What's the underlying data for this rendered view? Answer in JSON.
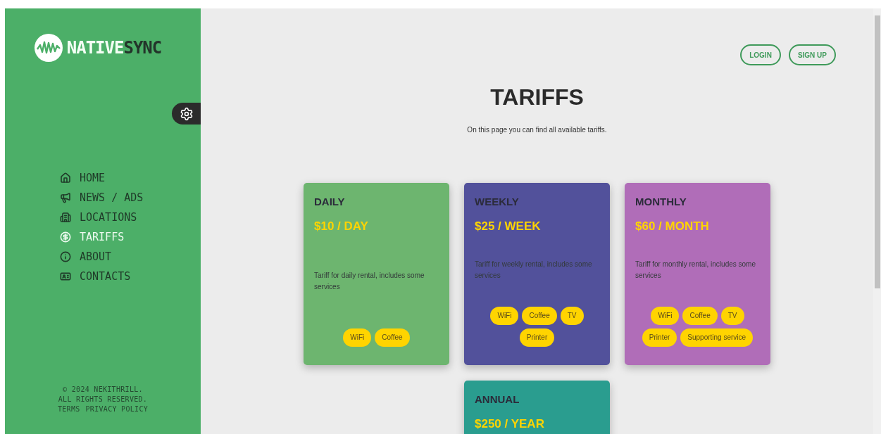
{
  "sidebar": {
    "logo": {
      "primary": "NATIVE",
      "secondary": "SYNC"
    },
    "nav": [
      {
        "label": "HOME",
        "selected": false
      },
      {
        "label": "NEWS / ADS",
        "selected": false
      },
      {
        "label": "LOCATIONS",
        "selected": false
      },
      {
        "label": "TARIFFS",
        "selected": true
      },
      {
        "label": "ABOUT",
        "selected": false
      },
      {
        "label": "CONTACTS",
        "selected": false
      }
    ],
    "footer": {
      "copyright": "© 2024 NEKITHRILL.",
      "rights": "ALL RIGHTS RESERVED.",
      "links": [
        "TERMS",
        "PRIVACY POLICY"
      ]
    }
  },
  "header": {
    "buttons": [
      "LOGIN",
      "SIGN UP"
    ]
  },
  "title": "TARIFFS",
  "subtitle": "On this page you can find all available tariffs.",
  "tariffs": [
    {
      "name": "DAILY",
      "price": "$10 / DAY",
      "color": "#6db56f",
      "description": "Tariff for daily rental, includes some services",
      "services": [
        "WiFi",
        "Coffee"
      ]
    },
    {
      "name": "WEEKLY",
      "price": "$25 / WEEK",
      "color": "#52519b",
      "description": "Tariff for weekly rental, includes some services",
      "services": [
        "WiFi",
        "Coffee",
        "TV",
        "Printer"
      ]
    },
    {
      "name": "MONTHLY",
      "price": "$60 / MONTH",
      "color": "#b06db8",
      "description": "Tariff for monthly rental, includes some services",
      "services": [
        "WiFi",
        "Coffee",
        "TV",
        "Printer",
        "Supporting service"
      ]
    },
    {
      "name": "ANNUAL",
      "price": "$250 / YEAR",
      "color": "#2a9d8f"
    }
  ]
}
